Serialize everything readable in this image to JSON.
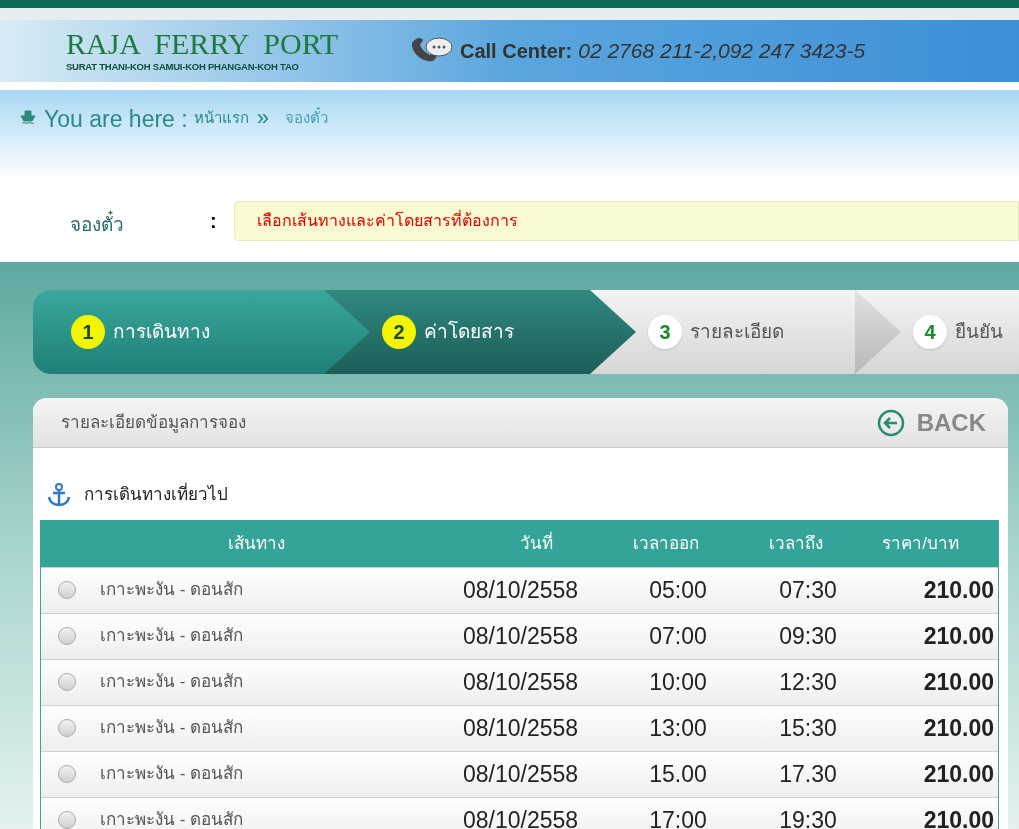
{
  "header": {
    "logo_title": "RAJA  FERRY  PORT",
    "logo_subtitle": "SURAT THANI-KOH SAMUI-KOH PHANGAN-KOH TAO",
    "call_center_label": "Call Center:",
    "call_center_numbers": "02 2768 211-2,092 247 3423-5"
  },
  "breadcrumb": {
    "label": "You are here :",
    "items": [
      {
        "text": "หน้าแรก",
        "current": false
      },
      {
        "text": "จองตั๋ว",
        "current": true
      }
    ],
    "separator": "»"
  },
  "booking": {
    "label": "จองตั๋ว",
    "colon": ":",
    "message": "เลือกเส้นทางและค่าโดยสารที่ต้องการ"
  },
  "steps": [
    {
      "number": "1",
      "label": "การเดินทาง",
      "completed": true,
      "selected": false
    },
    {
      "number": "2",
      "label": "ค่าโดยสาร",
      "completed": false,
      "selected": true
    },
    {
      "number": "3",
      "label": "รายละเอียด",
      "completed": false,
      "selected": false
    },
    {
      "number": "4",
      "label": "ยืนยัน",
      "completed": false,
      "selected": false
    }
  ],
  "panel": {
    "title": "รายละเอียดข้อมูลการจอง",
    "back_button": "BACK",
    "section_title": "การเดินทางเที่ยวไป"
  },
  "table": {
    "columns": [
      "เส้นทาง",
      "วันที่",
      "เวลาออก",
      "เวลาถึง",
      "ราคา/บาท"
    ],
    "rows": [
      {
        "selected": false,
        "route": "เกาะพะงัน - ดอนสัก",
        "date": "08/10/2558",
        "depart": "05:00",
        "arrive": "07:30",
        "price": "210.00"
      },
      {
        "selected": false,
        "route": "เกาะพะงัน - ดอนสัก",
        "date": "08/10/2558",
        "depart": "07:00",
        "arrive": "09:30",
        "price": "210.00"
      },
      {
        "selected": false,
        "route": "เกาะพะงัน - ดอนสัก",
        "date": "08/10/2558",
        "depart": "10:00",
        "arrive": "12:30",
        "price": "210.00"
      },
      {
        "selected": false,
        "route": "เกาะพะงัน - ดอนสัก",
        "date": "08/10/2558",
        "depart": "13:00",
        "arrive": "15:30",
        "price": "210.00"
      },
      {
        "selected": false,
        "route": "เกาะพะงัน - ดอนสัก",
        "date": "08/10/2558",
        "depart": "15.00",
        "arrive": "17.30",
        "price": "210.00"
      },
      {
        "selected": false,
        "route": "เกาะพะงัน - ดอนสัก",
        "date": "08/10/2558",
        "depart": "17:00",
        "arrive": "19:30",
        "price": "210.00"
      }
    ]
  }
}
